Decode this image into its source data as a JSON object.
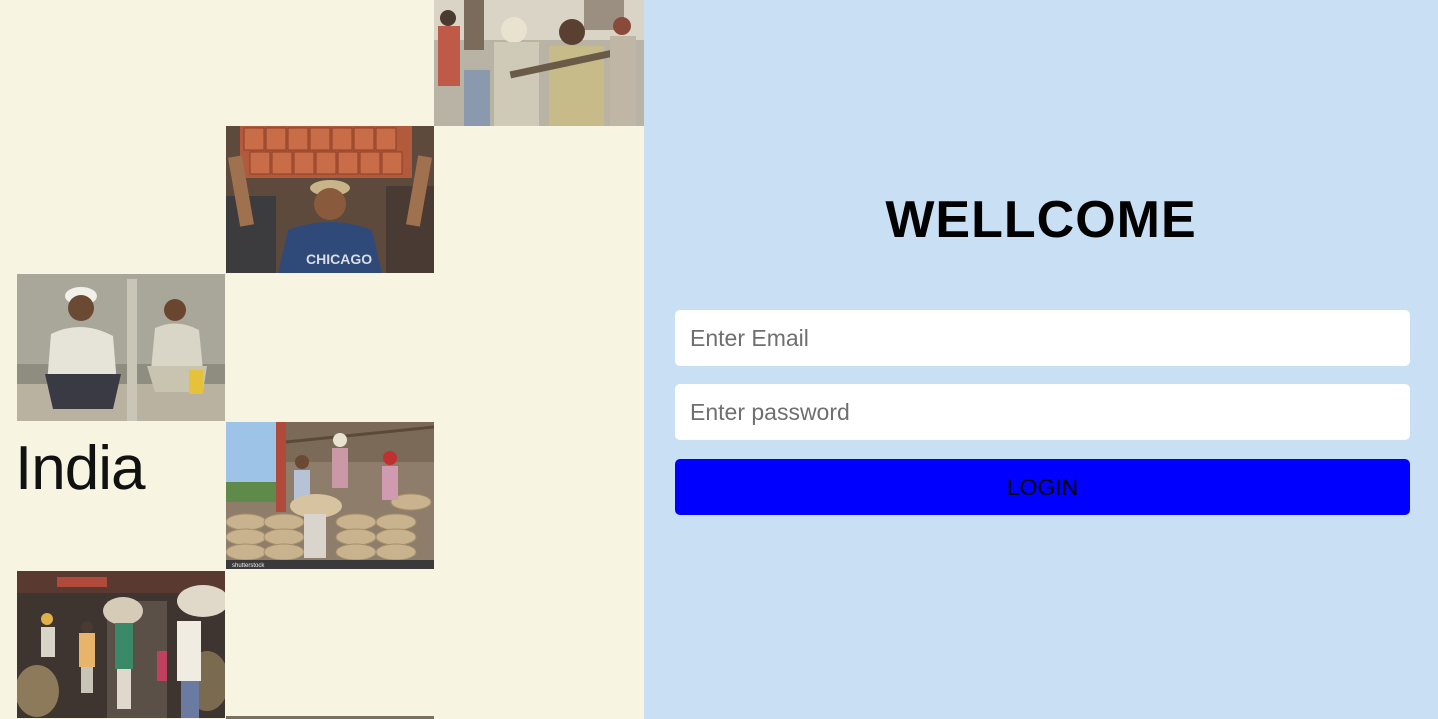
{
  "hero": {
    "country_label": "India",
    "photos": [
      {
        "icon": "workers-with-tools-photo"
      },
      {
        "icon": "brick-carrier-photo"
      },
      {
        "icon": "resting-workers-photo"
      },
      {
        "icon": "sack-loaders-photo",
        "watermark": "shutterstock"
      },
      {
        "icon": "market-porters-photo"
      }
    ]
  },
  "login": {
    "title": "WELLCOME",
    "email_placeholder": "Enter Email",
    "password_placeholder": "Enter password",
    "button_label": "LOGIN"
  },
  "colors": {
    "left_background": "#f7f4e2",
    "right_background": "#c9e0f4",
    "button": "#0000fe"
  }
}
